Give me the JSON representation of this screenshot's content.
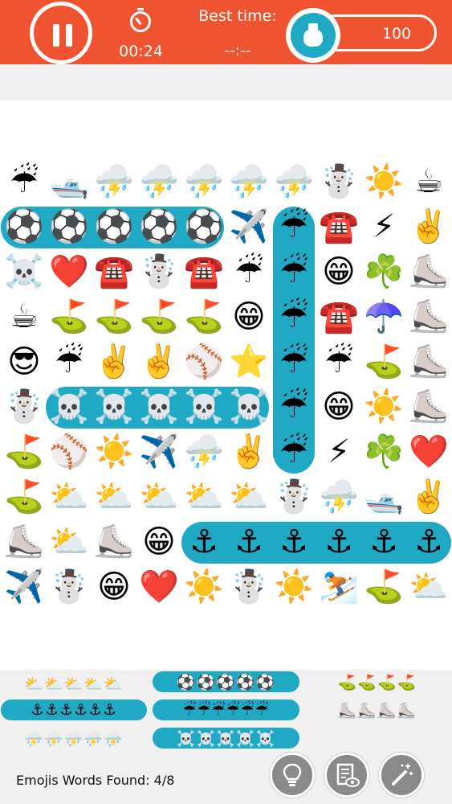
{
  "header": {
    "timer": "00:24",
    "best_time_label": "Best time:",
    "best_time_value": "--:--",
    "coins": "100"
  },
  "grid_rows": [
    [
      "☔",
      "🛥️",
      "⛈️",
      "⛈️",
      "⛈️",
      "⛈️",
      "⛈️",
      "☃️",
      "☀️",
      "☕"
    ],
    [
      "⚽",
      "⚽",
      "⚽",
      "⚽",
      "⚽",
      "✈️",
      "☔",
      "☎️",
      "⚡",
      "✌️"
    ],
    [
      "☠️",
      "❤️",
      "☎️",
      "☃️",
      "☎️",
      "☔",
      "☔",
      "😁",
      "☘️",
      "⛸️"
    ],
    [
      "☕",
      "⛳",
      "⛳",
      "⛳",
      "⛳",
      "😁",
      "☔",
      "☎️",
      "☂️",
      "⛸️"
    ],
    [
      "😎",
      "☔",
      "✌️",
      "✌️",
      "⚾",
      "⭐",
      "☔",
      "☔",
      "⛳",
      "⛸️"
    ],
    [
      "☃️",
      "☠️",
      "☠️",
      "☠️",
      "☠️",
      "☠️",
      "☔",
      "😁",
      "☀️",
      "⛸️"
    ],
    [
      "⛳",
      "⚾",
      "☀️",
      "✈️",
      "⛈️",
      "✌️",
      "☔",
      "⚡",
      "☘️",
      "❤️"
    ],
    [
      "⛳",
      "⛅",
      "⛅",
      "⛅",
      "⛅",
      "⛅",
      "☃️",
      "⛈️",
      "🛥️",
      "✌️"
    ],
    [
      "⛸️",
      "⛅",
      "⛸️",
      "😁",
      "⚓",
      "⚓",
      "⚓",
      "⚓",
      "⚓",
      "⚓"
    ],
    [
      "✈️",
      "☃️",
      "😁",
      "❤️",
      "☀️",
      "☃️",
      "☀️",
      "⛷️",
      "⛳",
      "⛅"
    ]
  ],
  "word_bank": [
    {
      "emojis": "⛅⛅⛅⛅⛅",
      "found": false
    },
    {
      "emojis": "⚽⚽⚽⚽⚽",
      "found": true
    },
    {
      "emojis": "⛳⛳⛳⛳",
      "found": false
    },
    {
      "emojis": "⚓⚓⚓⚓⚓⚓",
      "found": true
    },
    {
      "emojis": "☔☔☔☔☔☔",
      "found": true
    },
    {
      "emojis": "⛸️⛸️⛸️⛸️",
      "found": false
    },
    {
      "emojis": "⛈️⛈️⛈️⛈️⛈️",
      "found": false
    },
    {
      "emojis": "☠️☠️☠️☠️☠️",
      "found": true
    }
  ],
  "footer": {
    "found_text": "Emojis Words Found: 4/8"
  },
  "icons": {
    "pause": "pause-icon",
    "timer": "stopwatch-icon",
    "coins": "money-bag-icon",
    "hint": "lightbulb-icon",
    "review": "list-eye-icon",
    "magic": "magic-wand-icon"
  },
  "colors": {
    "header": "#f0532f",
    "found_highlight": "#1fa9c5",
    "panel": "#f0f0f0",
    "button": "#8a8a8a"
  }
}
